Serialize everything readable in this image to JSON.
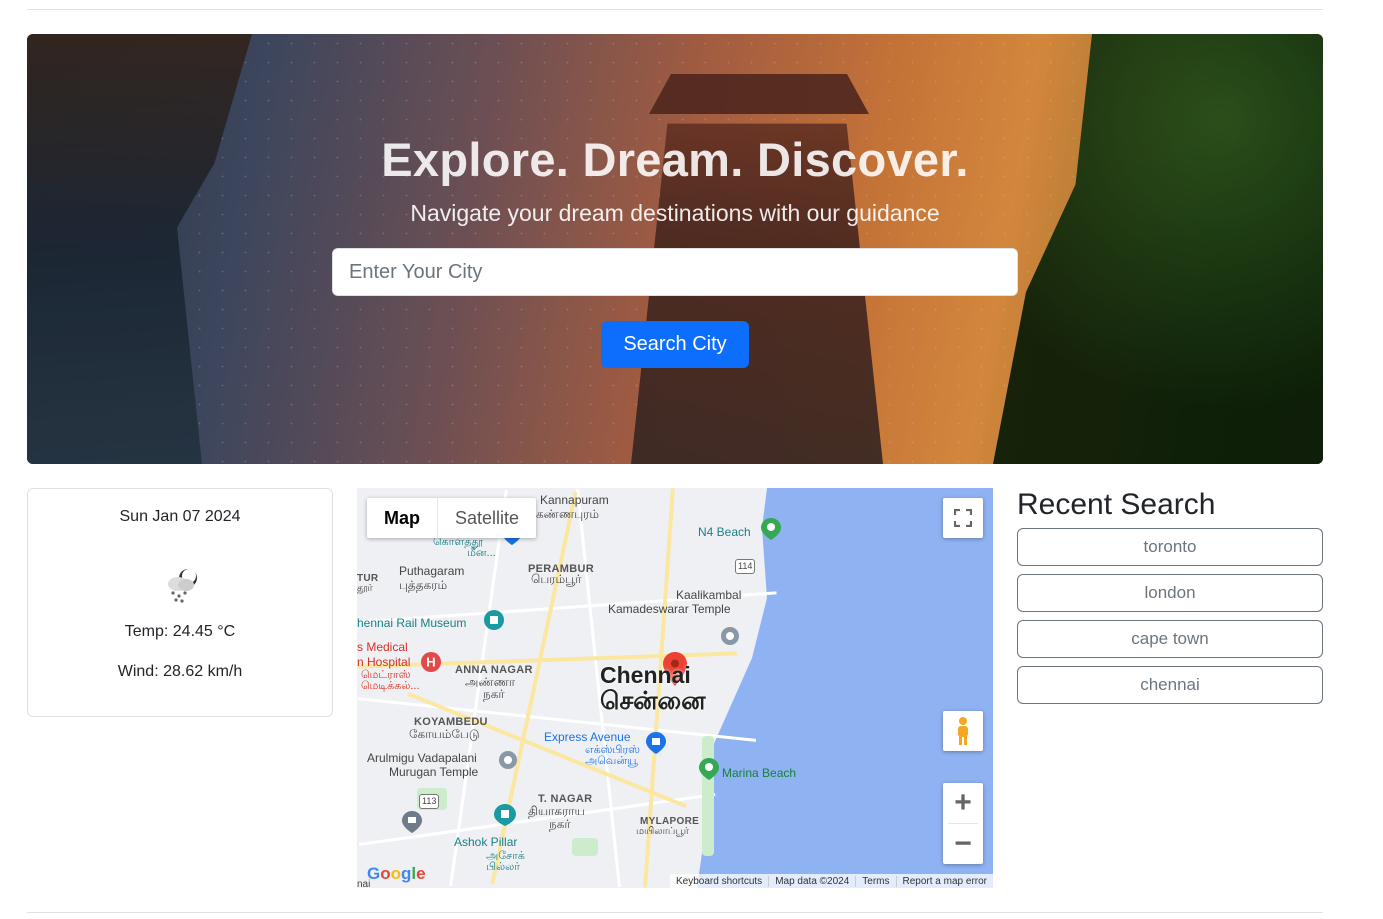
{
  "hero": {
    "title": "Explore. Dream. Discover.",
    "subtitle": "Navigate your dream destinations with our guidance",
    "search_placeholder": "Enter Your City",
    "search_button": "Search City"
  },
  "weather": {
    "date": "Sun Jan 07 2024",
    "icon": "snow-cloud-icon",
    "temp": "Temp: 24.45 °C",
    "wind": "Wind: 28.62 km/h"
  },
  "map": {
    "type_buttons": [
      "Map",
      "Satellite"
    ],
    "city_name": "Chennai",
    "city_name_tamil": "சென்னை",
    "labels": {
      "kannapuram": "Kannapuram",
      "kannapuram_ta": "கண்ணபுரம்",
      "kolathur_ta": "கொளத்தூ",
      "kolathur_ta2": "மீன...",
      "n4beach": "N4 Beach",
      "puthagaram": "Puthagaram",
      "puthagaram_ta": "புத்தகரம்",
      "perambur": "PERAMBUR",
      "perambur_ta": "பெரம்பூர்",
      "tur": "TUR",
      "tur_ta": "தூர்",
      "kaalikambal": "Kaalikambal",
      "kaalikambal2": "Kamadeswarar Temple",
      "rail_museum": "hennai Rail Museum",
      "medical": "s Medical",
      "hospital": "n Hospital",
      "hospital_ta": "மெட்ராஸ்",
      "hospital_ta2": "மெடிக்கல்...",
      "anna_nagar": "ANNA NAGAR",
      "anna_nagar_ta": "அண்ணா",
      "anna_nagar_ta2": "நகர்",
      "koyambedu": "KOYAMBEDU",
      "koyambedu_ta": "கோயம்பேடு",
      "express_avenue": "Express Avenue",
      "express_avenue_ta": "எக்ஸ்பிரஸ்",
      "express_avenue_ta2": "அவென்யூ",
      "vadapalani": "Arulmigu Vadapalani",
      "vadapalani2": "Murugan Temple",
      "marina": "Marina Beach",
      "tnagar": "T. NAGAR",
      "tnagar_ta": "தியாகராய",
      "tnagar_ta2": "நகர்",
      "mylapore": "MYLAPORE",
      "mylapore_ta": "மயிலாப்பூர்",
      "ashok": "Ashok Pillar",
      "ashok_ta": "அசோக்",
      "ashok_ta2": "பில்லர்",
      "r114": "114",
      "r113": "113",
      "nai": "nai"
    },
    "attribution": [
      "Keyboard shortcuts",
      "Map data ©2024",
      "Terms",
      "Report a map error"
    ],
    "logo": "Google"
  },
  "recent": {
    "heading": "Recent Search",
    "items": [
      "toronto",
      "london",
      "cape town",
      "chennai"
    ]
  }
}
